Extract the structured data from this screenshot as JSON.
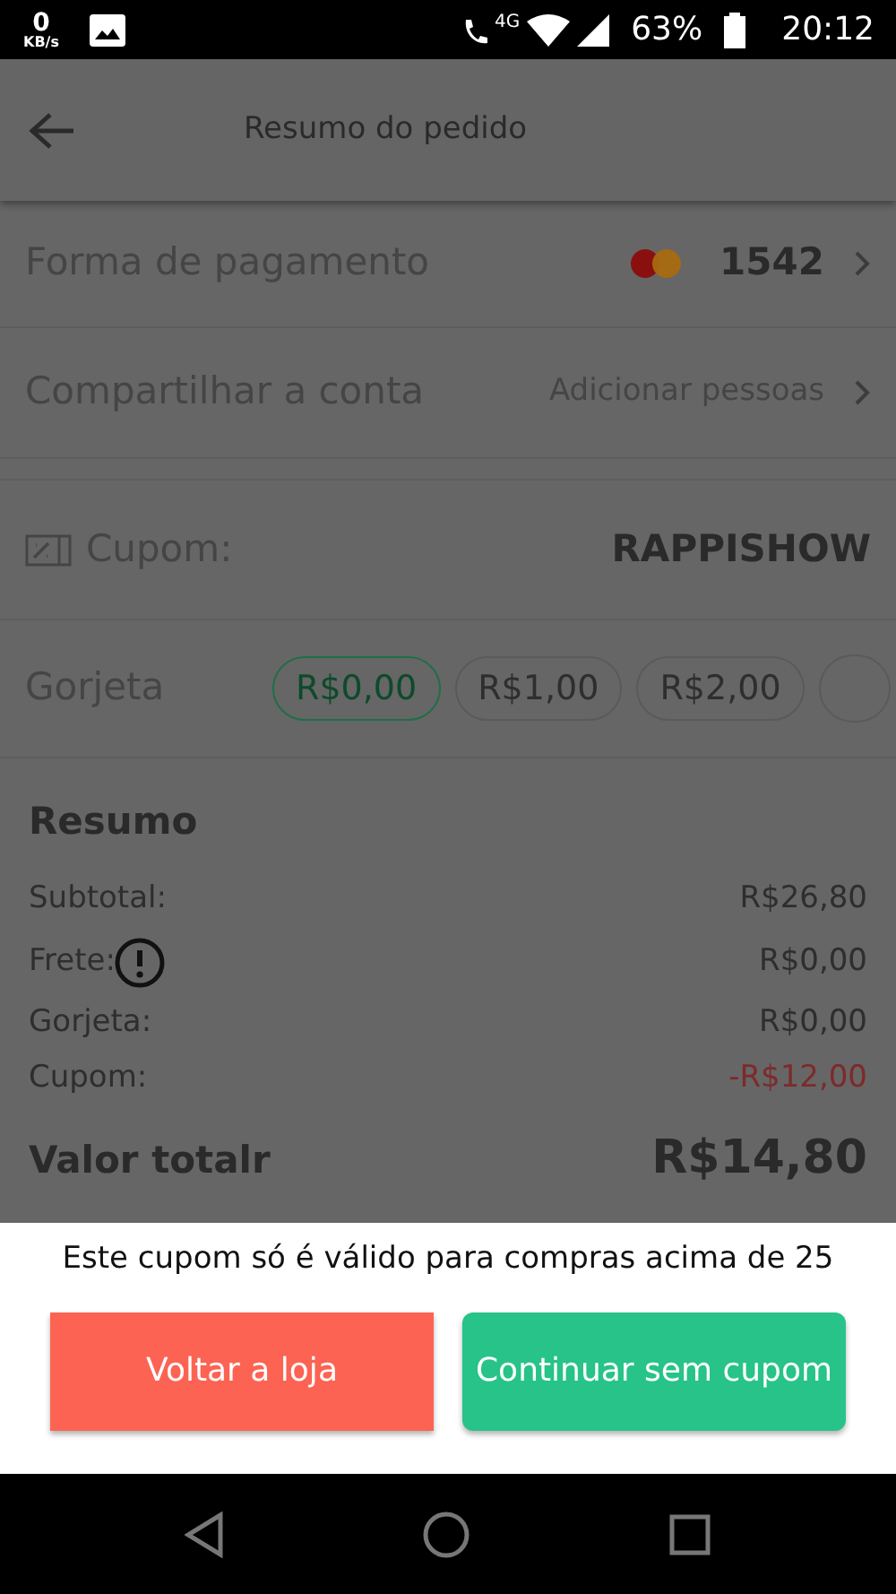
{
  "status_bar": {
    "speed": "0",
    "speed_unit": "KB/s",
    "network": "4G",
    "battery": "63%",
    "time": "20:12"
  },
  "header": {
    "title": "Resumo do pedido"
  },
  "payment": {
    "label": "Forma de pagamento",
    "card": "1542"
  },
  "share": {
    "label": "Compartilhar a conta",
    "action": "Adicionar pessoas"
  },
  "coupon": {
    "label": "Cupom:",
    "code": "RAPPISHOW"
  },
  "tip": {
    "label": "Gorjeta",
    "options": [
      {
        "label": "R$0,00",
        "selected": true
      },
      {
        "label": "R$1,00",
        "selected": false
      },
      {
        "label": "R$2,00",
        "selected": false
      }
    ]
  },
  "summary": {
    "title": "Resumo",
    "lines": [
      {
        "label": "Subtotal:",
        "value": "R$26,80",
        "kind": "plain"
      },
      {
        "label": "Frete:",
        "value": "R$0,00",
        "kind": "warning"
      },
      {
        "label": "Gorjeta:",
        "value": "R$0,00",
        "kind": "plain"
      },
      {
        "label": "Cupom:",
        "value": "-R$12,00",
        "kind": "discount"
      }
    ],
    "total_label": "Valor totalr",
    "total": "R$14,80"
  },
  "dialog": {
    "message": "Este cupom só é válido para compras acima de 25",
    "buttons": [
      {
        "label": "Voltar a loja",
        "kind": "secondary"
      },
      {
        "label": "Continuar sem cupom",
        "kind": "primary"
      }
    ]
  }
}
